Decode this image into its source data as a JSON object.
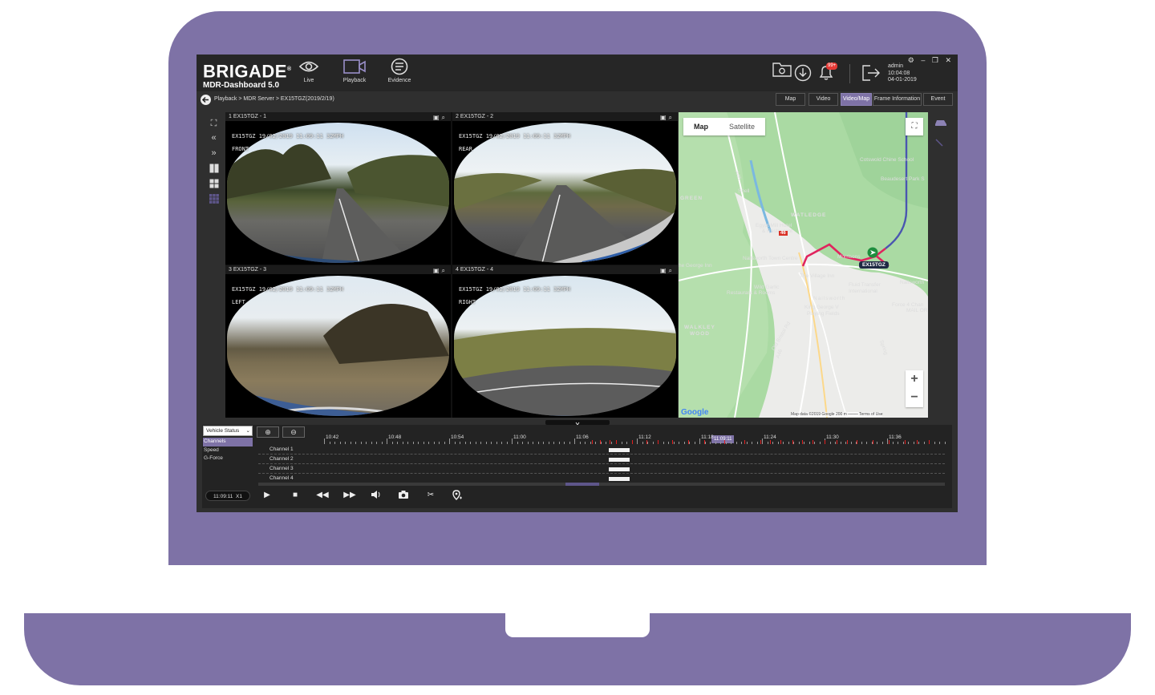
{
  "app": {
    "logo_line1": "BRIGADE",
    "logo_mark": "®",
    "logo_line2": "MDR-Dashboard 5.0"
  },
  "nav": [
    {
      "label": "Live",
      "icon": "eye-icon"
    },
    {
      "label": "Playback",
      "icon": "video-camera-icon"
    },
    {
      "label": "Evidence",
      "icon": "evidence-list-icon"
    }
  ],
  "header_right": {
    "notification_badge": "99+",
    "user": "admin",
    "time": "10:04:08",
    "date": "04-01-2019",
    "window_controls": [
      "⚙",
      "–",
      "❐",
      "✕"
    ]
  },
  "breadcrumb": "Playback > MDR Server > EX15TGZ(2019/2/19)",
  "view_tabs": [
    {
      "label": "Map",
      "active": false
    },
    {
      "label": "Video",
      "active": false
    },
    {
      "label": "Video/Map",
      "active": true
    },
    {
      "label": "Frame Information",
      "active": false
    },
    {
      "label": "Event",
      "active": false
    }
  ],
  "videos": [
    {
      "caption": "1 EX15TGZ - 1",
      "osd_top": "EX15TGZ  19/02/2019 11:09:11  32MPH",
      "osd_side": "FRONT"
    },
    {
      "caption": "2 EX15TGZ - 2",
      "osd_top": "EX15TGZ  19/02/2019 11:09:11  32MPH",
      "osd_side": "REAR"
    },
    {
      "caption": "3 EX15TGZ - 3",
      "osd_top": "EX15TGZ  19/02/2019 11:09:11  32MPH",
      "osd_side": "LEFT"
    },
    {
      "caption": "4 EX15TGZ - 4",
      "osd_top": "EX15TGZ  19/02/2019 11:09:11  32MPH",
      "osd_side": "RIGHT"
    }
  ],
  "map": {
    "type_map": "Map",
    "type_satellite": "Satellite",
    "zoom_in": "+",
    "zoom_out": "−",
    "vehicle_label": "EX15TGZ",
    "road_badge": "46",
    "attribution": "Map data ©2019 Google   200 m ⎯⎯⎯⎯⎯   Terms of Use",
    "google": "Google",
    "labels": [
      {
        "text": "Cotswold Chine School",
        "color": "#3c4043"
      },
      {
        "text": "Beaudesert Park S",
        "color": "#3c4043"
      },
      {
        "text": "GREEN",
        "color": "#3c4043"
      },
      {
        "text": "Shell",
        "color": "#3c4043"
      },
      {
        "text": "WATLEDGE",
        "color": "#3c4043"
      },
      {
        "text": "Egypt Mill Hotel",
        "color": "#c5221f"
      },
      {
        "text": "& Restaurant",
        "color": "#c5221f"
      },
      {
        "text": "Nailsworth Town Centre",
        "color": "#1a73e8"
      },
      {
        "text": "Morrisons",
        "color": "#3c4043"
      },
      {
        "text": "he George Inn",
        "color": "#c5221f"
      },
      {
        "text": "The Village Inn",
        "color": "#c5221f"
      },
      {
        "text": "Fluid Transfer",
        "color": "#3c4043"
      },
      {
        "text": "International",
        "color": "#3c4043"
      },
      {
        "text": "Nailsworth",
        "color": "#1a73e8"
      },
      {
        "text": "Wild Garlic",
        "color": "#c5221f"
      },
      {
        "text": "Restaurant & Rooms",
        "color": "#c5221f"
      },
      {
        "text": "Nailsworth",
        "color": "#7a7a7a"
      },
      {
        "text": "King George V",
        "color": "#188038"
      },
      {
        "text": "Playing Fields",
        "color": "#188038"
      },
      {
        "text": "Force 4 Chan",
        "color": "#3c4043"
      },
      {
        "text": "MAIL OR",
        "color": "#3c4043"
      },
      {
        "text": "WALKLEY",
        "color": "#3c4043"
      },
      {
        "text": "WOOD",
        "color": "#3c4043"
      },
      {
        "text": "A46",
        "color": "#5f6368"
      },
      {
        "text": "A46",
        "color": "#5f6368"
      },
      {
        "text": "Spring",
        "color": "#5f6368"
      },
      {
        "text": "Old Bristol Rd",
        "color": "#5f6368"
      }
    ]
  },
  "timeline": {
    "status_select": "Vehicle Status",
    "status_options": [
      {
        "label": "Channels",
        "selected": true
      },
      {
        "label": "Speed",
        "selected": false
      },
      {
        "label": "G-Force",
        "selected": false
      }
    ],
    "ticks": [
      "10:42",
      "10:48",
      "10:54",
      "11:00",
      "11:06",
      "11:12",
      "11:18",
      "11:24",
      "11:30",
      "11:36"
    ],
    "cursor_time": "11:09:11",
    "channels": [
      "Channel 1",
      "Channel 2",
      "Channel 3",
      "Channel 4"
    ],
    "play_time": "11:09:11",
    "speed": "X1"
  }
}
